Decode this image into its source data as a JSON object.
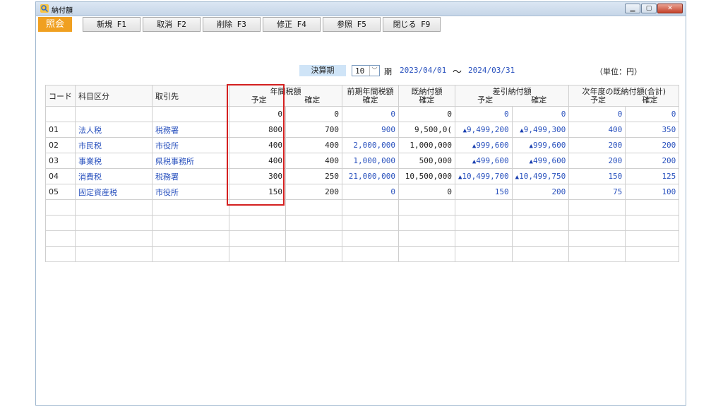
{
  "window": {
    "title": "納付額"
  },
  "toolbar": {
    "mode": "照会",
    "buttons": [
      "新規 F1",
      "取消 F2",
      "削除 F3",
      "修正 F4",
      "参照 F5",
      "閉じる F9"
    ]
  },
  "period": {
    "label": "決算期",
    "value": "10",
    "suffix": "期",
    "date_from": "2023/04/01",
    "tilde": "〜",
    "date_to": "2024/03/31",
    "unit": "（単位：円）"
  },
  "table": {
    "headers": {
      "code": "コード",
      "category": "科目区分",
      "counterparty": "取引先",
      "annual": "年間税額",
      "annual_plan": "予定",
      "annual_fixed": "確定",
      "prev_year": "前期年間税額",
      "prev_fixed": "確定",
      "paid": "既納付額",
      "paid_fixed": "確定",
      "diff": "差引納付額",
      "diff_plan": "予定",
      "diff_fixed": "確定",
      "next": "次年度の既納付額(合計)",
      "next_plan": "予定",
      "next_fixed": "確定"
    },
    "rows": [
      {
        "code": "",
        "category": "",
        "counterparty": "",
        "plan": "0",
        "fixed": "0",
        "prev": "0",
        "paid": "0",
        "diff_plan": "0",
        "diff_fixed": "0",
        "next_plan": "0",
        "next_fixed": "0"
      },
      {
        "code": "01",
        "category": "法人税",
        "counterparty": "税務署",
        "plan": "800",
        "fixed": "700",
        "prev": "900",
        "paid": "9,500,0(",
        "diff_plan": "▲9,499,200",
        "diff_fixed": "▲9,499,300",
        "next_plan": "400",
        "next_fixed": "350"
      },
      {
        "code": "02",
        "category": "市民税",
        "counterparty": "市役所",
        "plan": "400",
        "fixed": "400",
        "prev": "2,000,000",
        "paid": "1,000,000",
        "diff_plan": "▲999,600",
        "diff_fixed": "▲999,600",
        "next_plan": "200",
        "next_fixed": "200"
      },
      {
        "code": "03",
        "category": "事業税",
        "counterparty": "県税事務所",
        "plan": "400",
        "fixed": "400",
        "prev": "1,000,000",
        "paid": "500,000",
        "diff_plan": "▲499,600",
        "diff_fixed": "▲499,600",
        "next_plan": "200",
        "next_fixed": "200"
      },
      {
        "code": "04",
        "category": "消費税",
        "counterparty": "税務署",
        "plan": "300",
        "fixed": "250",
        "prev": "21,000,000",
        "paid": "10,500,000",
        "diff_plan": "▲10,499,700",
        "diff_fixed": "▲10,499,750",
        "next_plan": "150",
        "next_fixed": "125"
      },
      {
        "code": "05",
        "category": "固定資産税",
        "counterparty": "市役所",
        "plan": "150",
        "fixed": "200",
        "prev": "0",
        "paid": "0",
        "diff_plan": "150",
        "diff_fixed": "200",
        "next_plan": "75",
        "next_fixed": "100"
      }
    ]
  },
  "colors": {
    "accent_mode": "#f0a020",
    "link_blue": "#2a52be",
    "highlight": "#d42020"
  }
}
